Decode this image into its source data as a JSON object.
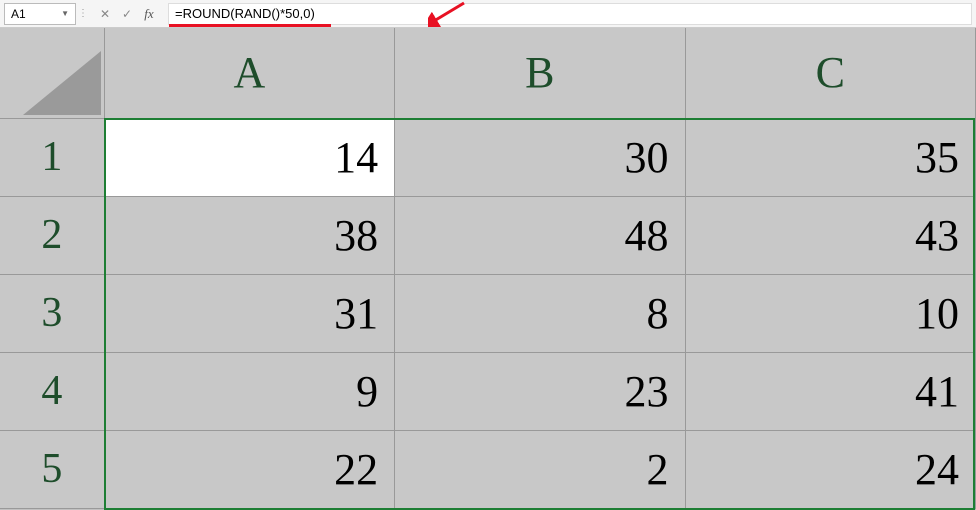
{
  "name_box": {
    "value": "A1"
  },
  "formula_bar": {
    "cancel_label": "✕",
    "enter_label": "✓",
    "fx_label": "fx",
    "formula": "=ROUND(RAND()*50,0)"
  },
  "columns": [
    "A",
    "B",
    "C"
  ],
  "rows": [
    "1",
    "2",
    "3",
    "4",
    "5"
  ],
  "cells": {
    "r1": {
      "a": "14",
      "b": "30",
      "c": "35"
    },
    "r2": {
      "a": "38",
      "b": "48",
      "c": "43"
    },
    "r3": {
      "a": "31",
      "b": "8",
      "c": "10"
    },
    "r4": {
      "a": "9",
      "b": "23",
      "c": "41"
    },
    "r5": {
      "a": "22",
      "b": "2",
      "c": "24"
    }
  },
  "active_cell": "A1"
}
